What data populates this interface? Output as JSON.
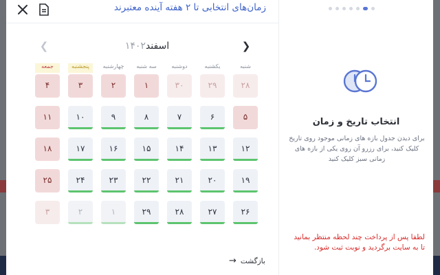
{
  "modal": {
    "title": "زمان‌های انتخابی تا ۲ هفته آینده معتبرند",
    "close_icon": "close-icon",
    "doc_icon": "document-icon"
  },
  "calendar": {
    "month": "اسفند",
    "year": "۱۴۰۲",
    "weekdays": [
      "شنبه",
      "یکشنبه",
      "دوشنبه",
      "سه شنبه",
      "چهارشنبه",
      "پنجشنبه",
      "جمعه"
    ],
    "rows": [
      [
        {
          "d": "۲۸",
          "s": "faded-red",
          "bar": ""
        },
        {
          "d": "۲۹",
          "s": "faded-red",
          "bar": ""
        },
        {
          "d": "۳۰",
          "s": "faded-red",
          "bar": ""
        },
        {
          "d": "۱",
          "s": "holiday",
          "bar": ""
        },
        {
          "d": "۲",
          "s": "holiday",
          "bar": ""
        },
        {
          "d": "۳",
          "s": "holiday",
          "bar": ""
        },
        {
          "d": "۴",
          "s": "holiday",
          "bar": ""
        }
      ],
      [
        {
          "d": "۵",
          "s": "holiday",
          "bar": ""
        },
        {
          "d": "۶",
          "s": "normal",
          "bar": "green"
        },
        {
          "d": "۷",
          "s": "normal",
          "bar": "green"
        },
        {
          "d": "۸",
          "s": "normal",
          "bar": "green"
        },
        {
          "d": "۹",
          "s": "normal",
          "bar": "green"
        },
        {
          "d": "۱۰",
          "s": "normal",
          "bar": "green"
        },
        {
          "d": "۱۱",
          "s": "holiday",
          "bar": ""
        }
      ],
      [
        {
          "d": "۱۲",
          "s": "normal",
          "bar": "green"
        },
        {
          "d": "۱۳",
          "s": "normal",
          "bar": "green"
        },
        {
          "d": "۱۴",
          "s": "normal",
          "bar": "green"
        },
        {
          "d": "۱۵",
          "s": "normal",
          "bar": "green"
        },
        {
          "d": "۱۶",
          "s": "normal",
          "bar": "green"
        },
        {
          "d": "۱۷",
          "s": "normal",
          "bar": "green"
        },
        {
          "d": "۱۸",
          "s": "holiday",
          "bar": ""
        }
      ],
      [
        {
          "d": "۱۹",
          "s": "normal",
          "bar": "green"
        },
        {
          "d": "۲۰",
          "s": "normal",
          "bar": "green"
        },
        {
          "d": "۲۱",
          "s": "normal",
          "bar": "green"
        },
        {
          "d": "۲۲",
          "s": "normal",
          "bar": "green"
        },
        {
          "d": "۲۳",
          "s": "normal",
          "bar": "green"
        },
        {
          "d": "۲۴",
          "s": "normal",
          "bar": "green"
        },
        {
          "d": "۲۵",
          "s": "holiday",
          "bar": ""
        }
      ],
      [
        {
          "d": "۲۶",
          "s": "normal",
          "bar": "green"
        },
        {
          "d": "۲۷",
          "s": "normal",
          "bar": "green"
        },
        {
          "d": "۲۸",
          "s": "normal",
          "bar": "green"
        },
        {
          "d": "۲۹",
          "s": "normal",
          "bar": "green"
        },
        {
          "d": "۱",
          "s": "faded",
          "bar": "light"
        },
        {
          "d": "۲",
          "s": "faded",
          "bar": "light"
        },
        {
          "d": "۳",
          "s": "faded-red",
          "bar": ""
        }
      ]
    ]
  },
  "back_label": "بازگشت",
  "info": {
    "title": "انتخاب تاریخ و زمان",
    "description": "برای دیدن جدول بازه های زمانی موجود روی تاریخ کلیک کنید، برای رزرو آن روی یکی از بازه های زمانی سبز کلیک کنید",
    "warning": "لطفا پس از پرداخت چند لحظه منتظر بمانید تا به سایت برگردید و نوبت ثبت شود.",
    "icon": "clock-icon"
  },
  "colors": {
    "accent": "#3f63c9",
    "available": "#5cc46e",
    "holiday": "#f2d9d9",
    "warning": "#d72b2b"
  }
}
